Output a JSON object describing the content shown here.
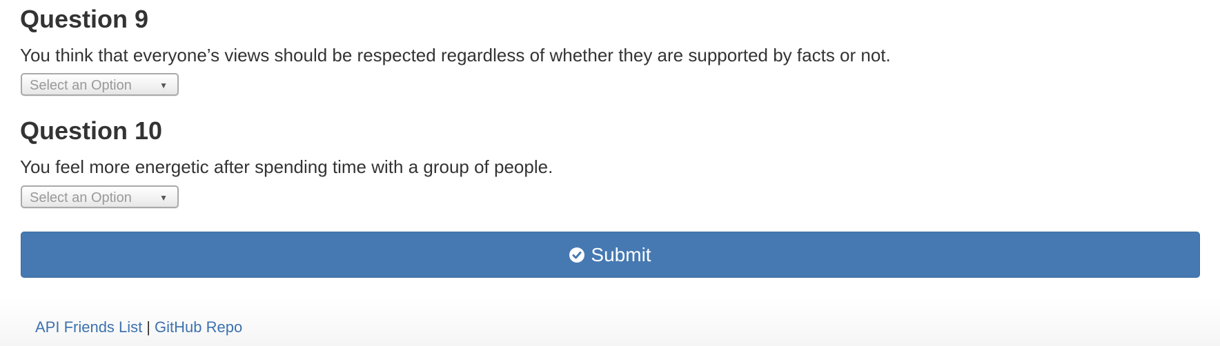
{
  "questions": [
    {
      "title": "Question 9",
      "text": "You think that everyone’s views should be respected regardless of whether they are supported by facts or not.",
      "select_value": "Select an Option"
    },
    {
      "title": "Question 10",
      "text": "You feel more energetic after spending time with a group of people.",
      "select_value": "Select an Option"
    }
  ],
  "submit": {
    "label": "Submit",
    "icon": "check-circle-icon",
    "color": "#4679b2"
  },
  "footer": {
    "links": [
      "API Friends List",
      "GitHub Repo"
    ],
    "separator": "|",
    "link_color": "#3c72ae"
  }
}
